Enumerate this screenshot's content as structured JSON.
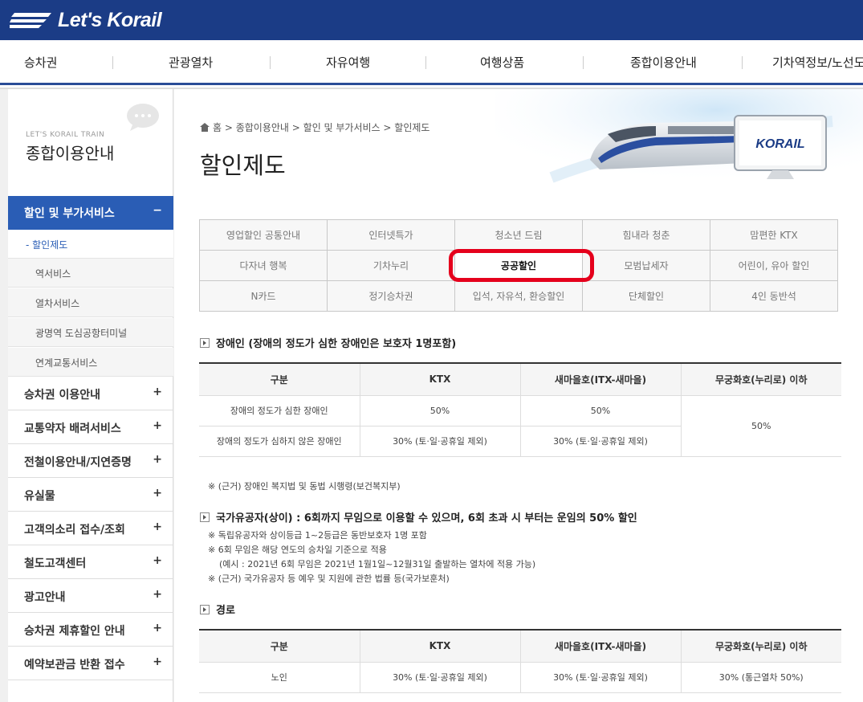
{
  "header": {
    "logo_text": "Let's Korail",
    "nav": [
      "승차권",
      "관광열차",
      "자유여행",
      "여행상품",
      "종합이용안내",
      "기차역정보/노선도"
    ]
  },
  "lnb": {
    "sub_title": "LET'S KORAIL TRAIN",
    "title": "종합이용안내",
    "active": {
      "label": "할인 및 부가서비스",
      "sign": "−"
    },
    "sub_items": [
      "- 할인제도",
      "역서비스",
      "열차서비스",
      "광명역 도심공항터미널",
      "연계교통서비스"
    ],
    "menu_items": [
      "승차권 이용안내",
      "교통약자 배려서비스",
      "전철이용안내/지연증명",
      "유실물",
      "고객의소리 접수/조회",
      "철도고객센터",
      "광고안내",
      "승차권 제휴할인 안내",
      "예약보관금 반환 접수"
    ],
    "plus": "+"
  },
  "content": {
    "breadcrumb": "홈 > 종합이용안내 > 할인 및 부가서비스 > 할인제도",
    "title": "할인제도",
    "banner_logo": "KORAIL",
    "tabs": [
      [
        "영업할인 공통안내",
        "인터넷특가",
        "청소년 드림",
        "힘내라 청춘",
        "맘편한 KTX"
      ],
      [
        "다자녀 행복",
        "기차누리",
        "공공할인",
        "모범납세자",
        "어린이, 유아 할인"
      ],
      [
        "N카드",
        "정기승차권",
        "입석, 자유석, 환승할인",
        "단체할인",
        "4인 동반석"
      ]
    ],
    "selected_tab": "공공할인",
    "sections": {
      "disabled": {
        "title": "장애인 (장애의 정도가 심한 장애인은 보호자 1명포함)",
        "headers": [
          "구분",
          "KTX",
          "새마을호(ITX-새마을)",
          "무궁화호(누리로) 이하"
        ],
        "rows": [
          [
            "장애의 정도가 심한 장애인",
            "50%",
            "50%"
          ],
          [
            "장애의 정도가 심하지 않은 장애인",
            "30% (토·일·공휴일 제외)",
            "30% (토·일·공휴일 제외)"
          ]
        ],
        "merged_value": "50%",
        "note": "※ (근거) 장애인 복지법 및 동법 시행령(보건복지부)"
      },
      "veteran": {
        "title": "국가유공자(상이) : 6회까지 무임으로 이용할 수 있으며, 6회 초과 시 부터는 운임의 50% 할인",
        "notes": [
          "※ 독립유공자와 상이등급 1~2등급은 동반보호자 1명 포함",
          "※ 6회 무임은 해당 연도의 승차일 기준으로 적용",
          "(예시 : 2021년 6회 무임은 2021년 1월1일~12월31일 출발하는 열차에 적용 가능)",
          "※ (근거) 국가유공자 등 예우 및 지원에 관한 법률 등(국가보훈처)"
        ]
      },
      "senior": {
        "title": "경로",
        "headers": [
          "구분",
          "KTX",
          "새마을호(ITX-새마을)",
          "무궁화호(누리로) 이하"
        ],
        "row": [
          "노인",
          "30% (토·일·공휴일 제외)",
          "30% (토·일·공휴일 제외)",
          "30% (통근열차 50%)"
        ]
      }
    }
  },
  "colors": {
    "header_bg": "#1b3c86",
    "lnb_active": "#2a5db5",
    "highlight_ring": "#e5001c"
  }
}
